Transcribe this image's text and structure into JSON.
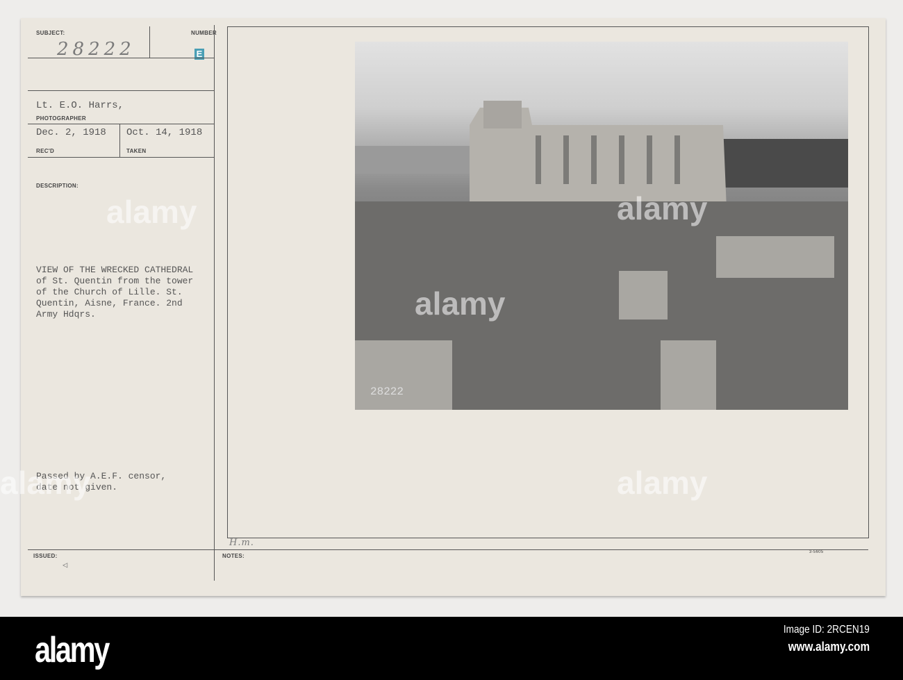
{
  "card": {
    "subject_label": "SUBJECT:",
    "subject_value": "28222",
    "number_label": "NUMBER",
    "number_stamp": "E",
    "photographer_value": "Lt. E.O. Harrs,",
    "photographer_label": "PHOTOGRAPHER",
    "received_value": "Dec. 2, 1918",
    "received_label": "REC'D",
    "taken_value": "Oct. 14, 1918",
    "taken_label": "TAKEN",
    "description_label": "DESCRIPTION:",
    "description_lines": [
      "VIEW OF THE WRECKED CATHEDRAL",
      "of St. Quentin from the tower",
      "of the Church of Lille. St.",
      "Quentin, Aisne, France. 2nd",
      "Army Hdqrs."
    ],
    "censor_lines": [
      "Passed by A.E.F. censor,",
      "date not given."
    ],
    "issued_label": "ISSUED:",
    "notes_label": "NOTES:",
    "notes_handwriting": "H.m.",
    "form_number": "3-5605",
    "photo_negative_number": "28222",
    "stamp_color": "#4a9fb5"
  },
  "watermark": {
    "text": "alamy"
  },
  "banner": {
    "logo": "alamy",
    "image_id": "Image ID: 2RCEN19",
    "url": "www.alamy.com"
  }
}
